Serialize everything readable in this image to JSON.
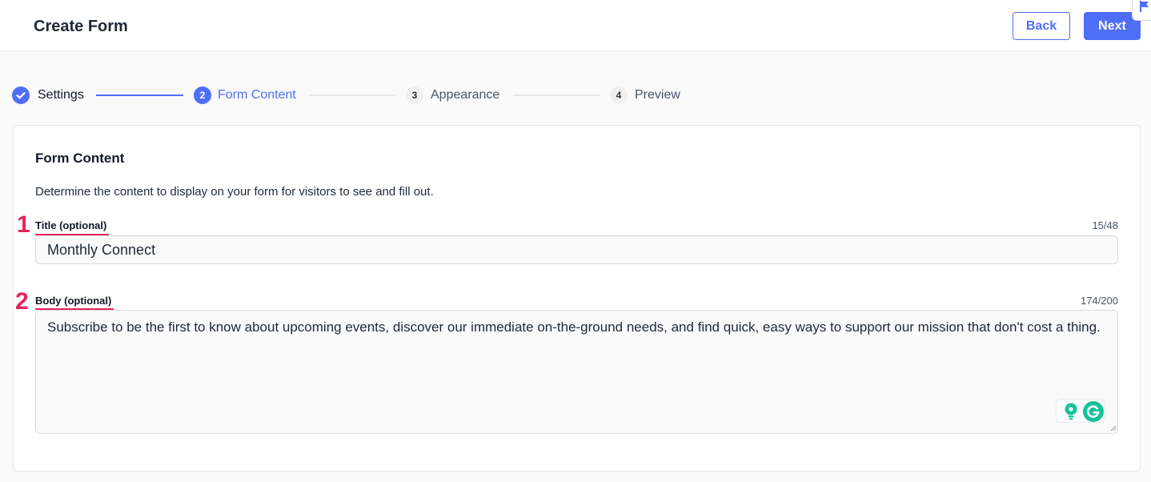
{
  "header": {
    "title": "Create Form",
    "back_label": "Back",
    "next_label": "Next"
  },
  "stepper": {
    "steps": [
      {
        "number": "",
        "label": "Settings",
        "state": "done"
      },
      {
        "number": "2",
        "label": "Form Content",
        "state": "active"
      },
      {
        "number": "3",
        "label": "Appearance",
        "state": "pending"
      },
      {
        "number": "4",
        "label": "Preview",
        "state": "pending"
      }
    ]
  },
  "card": {
    "heading": "Form Content",
    "description": "Determine the content to display on your form for visitors to see and fill out.",
    "fields": [
      {
        "marker": "1",
        "label": "Title (optional)",
        "counter": "15/48",
        "value": "Monthly Connect"
      },
      {
        "marker": "2",
        "label": "Body (optional)",
        "counter": "174/200",
        "value": "Subscribe to be the first to know about upcoming events, discover our immediate on-the-ground needs, and find quick, easy ways to support our mission that don't cost a thing."
      }
    ]
  },
  "icons": {
    "check": "check-icon",
    "flag": "flag-icon",
    "bulb": "lightbulb-icon",
    "grammarly": "grammarly-icon"
  },
  "colors": {
    "accent": "#4f6ef7",
    "annotation": "#e6245c",
    "grammarly": "#15c39a"
  }
}
